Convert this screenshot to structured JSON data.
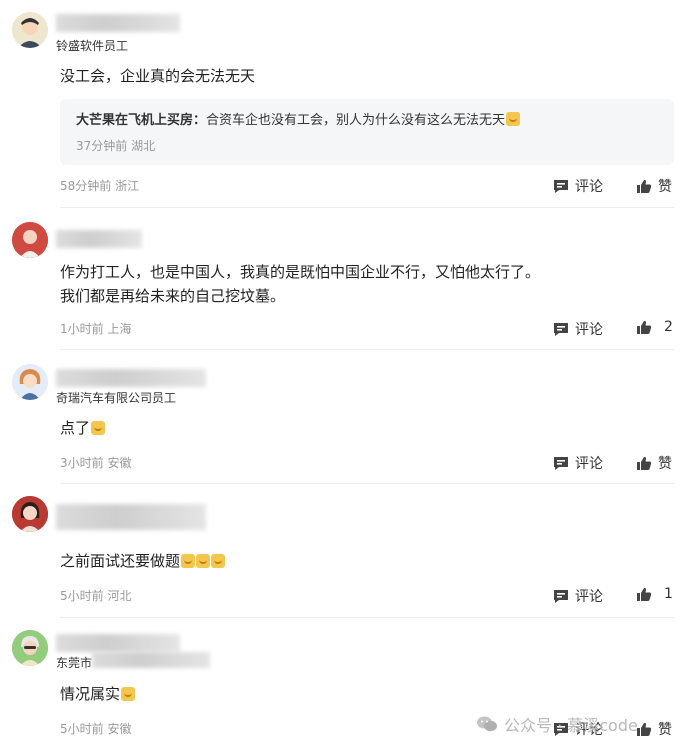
{
  "comments": [
    {
      "sub": "铃盛软件员工",
      "text": "没工会，企业真的会无法无天",
      "quote": {
        "author": "大芒果在飞机上买房",
        "sep": "：",
        "text": "合资车企也没有工会，别人为什么没有这么无法无天",
        "meta": "37分钟前 湖北"
      },
      "meta": "58分钟前 浙江",
      "comment_label": "评论",
      "like_label": "赞"
    },
    {
      "text_line1": "作为打工人，也是中国人，我真的是既怕中国企业不行，又怕他太行了。",
      "text_line2": "我们都是再给未来的自己挖坟墓。",
      "meta": "1小时前 上海",
      "comment_label": "评论",
      "like_label": "2"
    },
    {
      "sub": "奇瑞汽车有限公司员工",
      "text": "点了",
      "meta": "3小时前 安徽",
      "comment_label": "评论",
      "like_label": "赞"
    },
    {
      "text": "之前面试还要做题",
      "meta": "5小时前 河北",
      "comment_label": "评论",
      "like_label": "1"
    },
    {
      "sub": "东莞市",
      "text": "情况属实",
      "meta": "5小时前 安徽",
      "comment_label": "评论",
      "like_label": "赞"
    }
  ],
  "watermark": {
    "label": "公众号 · 慕溪code",
    "icon": "wechat-icon"
  },
  "colors": {
    "meta": "#999999",
    "quote_bg": "#f5f6f8",
    "divider": "#eeeeee"
  }
}
